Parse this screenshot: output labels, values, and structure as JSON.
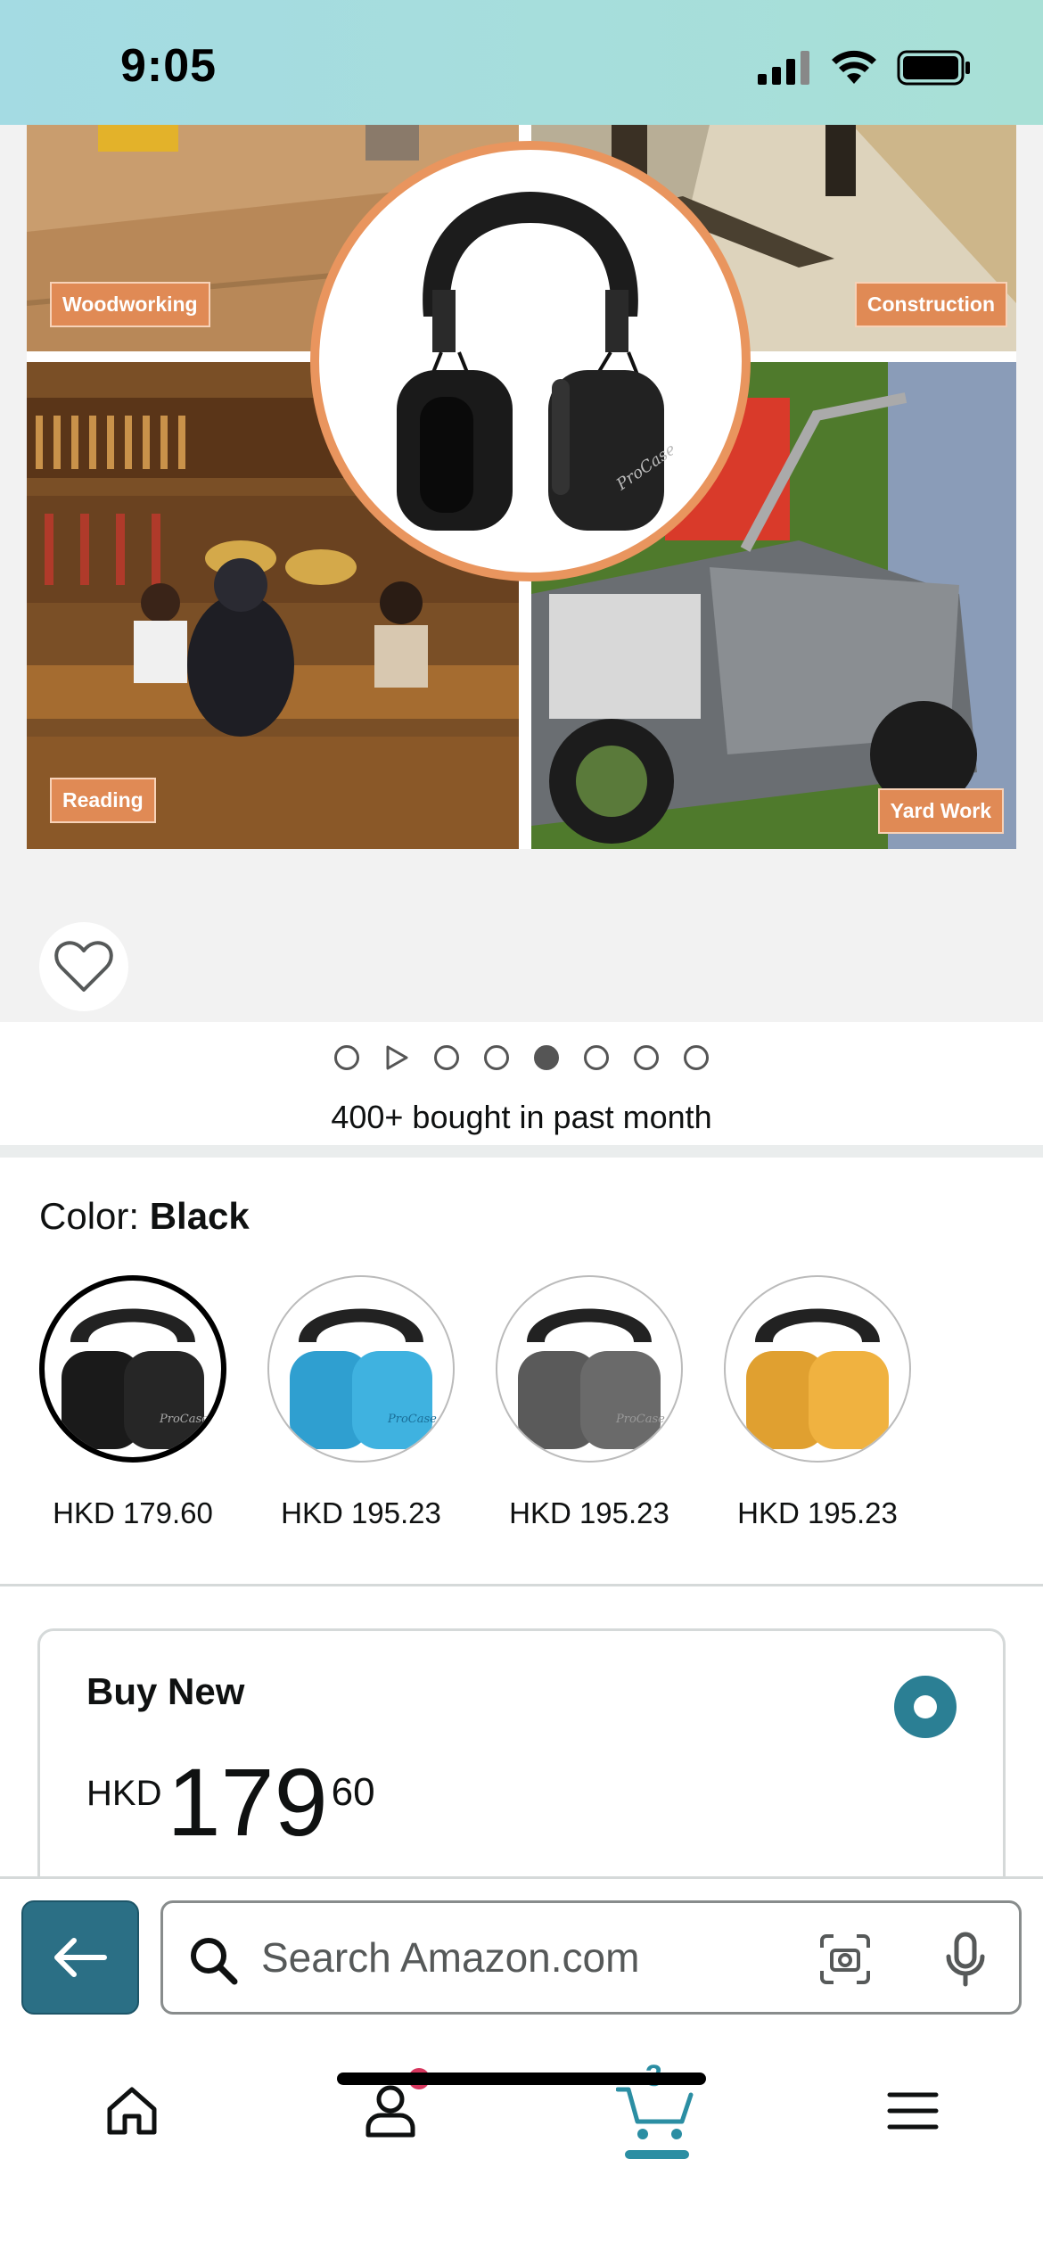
{
  "status_bar": {
    "time": "9:05"
  },
  "gallery": {
    "labels": {
      "woodworking": "Woodworking",
      "construction": "Construction",
      "reading": "Reading",
      "yard_work": "Yard Work"
    },
    "product_logo": "ProCase",
    "image_count": 8,
    "active_index": 4,
    "has_video": true
  },
  "social_proof": "400+ bought in past month",
  "color": {
    "label": "Color: ",
    "selected": "Black",
    "options": [
      {
        "name": "Black",
        "price": "HKD 179.60",
        "color": "#2a2a2a"
      },
      {
        "name": "Blue",
        "price": "HKD 195.23",
        "color": "#3fb2e0"
      },
      {
        "name": "Grey",
        "price": "HKD 195.23",
        "color": "#6a6a6a"
      },
      {
        "name": "Yellow",
        "price": "HKD 195.23",
        "color": "#f0b240"
      }
    ]
  },
  "buy_box": {
    "title": "Buy New",
    "currency": "HKD",
    "whole": "179",
    "fraction": "60"
  },
  "search": {
    "placeholder": "Search Amazon.com"
  },
  "nav": {
    "cart_count": "3",
    "tabs": [
      "home",
      "account",
      "cart",
      "menu"
    ]
  },
  "colors": {
    "accent": "#2b8ea3",
    "badge": "#d6365d",
    "label_bg": "#e08a55"
  }
}
